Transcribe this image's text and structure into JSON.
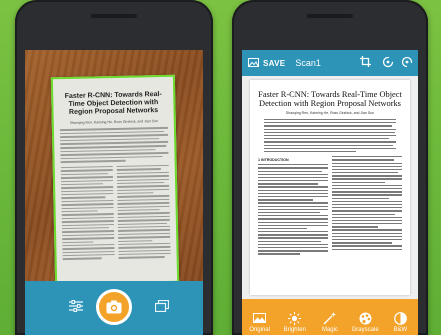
{
  "left_screen": {
    "document_title": "Faster R-CNN: Towards Real-Time Object Detection with Region Proposal Networks",
    "document_authors": "Shaoqing Ren, Kaiming He, Ross Girshick, and Jian Sun",
    "frame_color": "#6bdc2c",
    "toolbar": {
      "color": "#2d94b8",
      "shutter_color": "#f4a32a",
      "buttons": [
        "settings-sliders-icon",
        "camera-icon",
        "gallery-icon"
      ]
    }
  },
  "right_screen": {
    "topbar": {
      "save_label": "SAVE",
      "title": "Scan1",
      "icons": [
        "save-icon",
        "crop-icon",
        "rotate-left-icon",
        "rotate-right-icon"
      ],
      "color": "#2d94b8"
    },
    "document": {
      "title": "Faster R-CNN: Towards Real-Time Object Detection with Region Proposal Networks",
      "authors": "Shaoqing Ren, Kaiming He, Ross Girshick, and Jian Sun",
      "section_heading": "1   INTRODUCTION"
    },
    "filters": [
      {
        "label": "Original",
        "icon": "image-icon"
      },
      {
        "label": "Brighten",
        "icon": "sun-icon"
      },
      {
        "label": "Magic",
        "icon": "magic-wand-icon"
      },
      {
        "label": "Grayscale",
        "icon": "palette-icon"
      },
      {
        "label": "B&W",
        "icon": "contrast-icon"
      }
    ],
    "filter_bar_color": "#f3a22a"
  }
}
